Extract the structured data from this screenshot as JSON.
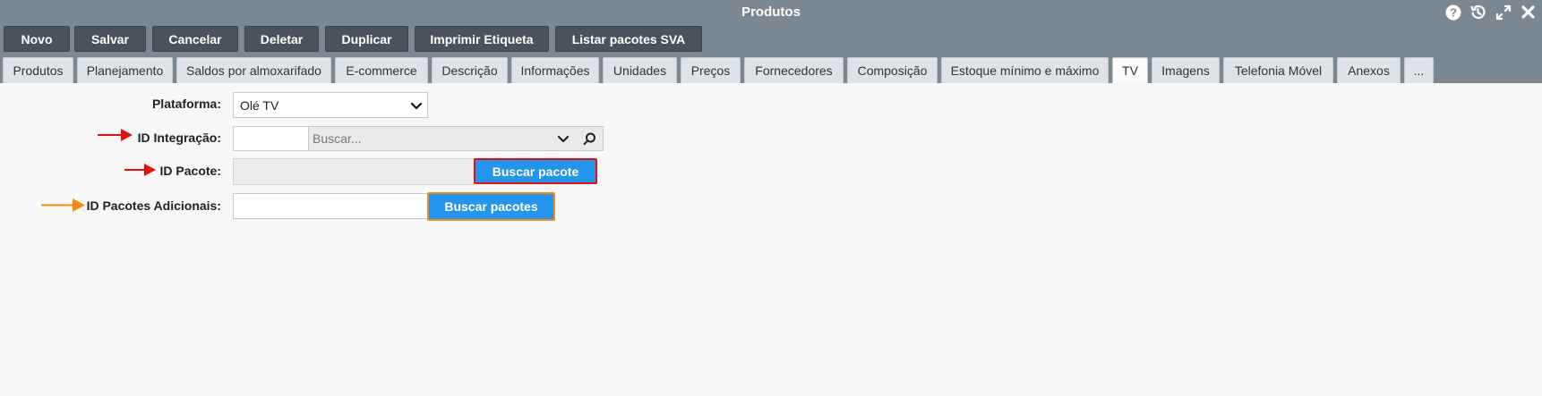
{
  "window": {
    "title": "Produtos"
  },
  "toolbar": {
    "buttons": [
      "Novo",
      "Salvar",
      "Cancelar",
      "Deletar",
      "Duplicar",
      "Imprimir Etiqueta",
      "Listar pacotes SVA"
    ]
  },
  "tabs": [
    {
      "label": "Produtos"
    },
    {
      "label": "Planejamento"
    },
    {
      "label": "Saldos por almoxarifado"
    },
    {
      "label": "E-commerce"
    },
    {
      "label": "Descrição"
    },
    {
      "label": "Informações"
    },
    {
      "label": "Unidades"
    },
    {
      "label": "Preços"
    },
    {
      "label": "Fornecedores"
    },
    {
      "label": "Composição"
    },
    {
      "label": "Estoque mínimo e máximo"
    },
    {
      "label": "TV"
    },
    {
      "label": "Imagens"
    },
    {
      "label": "Telefonia Móvel"
    },
    {
      "label": "Anexos"
    },
    {
      "label": "..."
    }
  ],
  "active_tab": "TV",
  "form": {
    "plataforma": {
      "label": "Plataforma:",
      "value": "Olé TV"
    },
    "id_integracao": {
      "label": "ID Integração:",
      "value": "",
      "search_placeholder": "Buscar..."
    },
    "id_pacote": {
      "label": "ID Pacote:",
      "value": "",
      "button": "Buscar pacote"
    },
    "id_pacotes_adicionais": {
      "label": "ID Pacotes Adicionais:",
      "value": "",
      "button": "Buscar pacotes"
    }
  },
  "colors": {
    "chrome": "#7b8892",
    "toolbar_button": "#4a535b",
    "tab": "#dde3e8",
    "primary_button": "#2495ea",
    "annotation_red": "#e21111",
    "annotation_orange": "#f28a18"
  },
  "icons": [
    "help-icon",
    "history-icon",
    "expand-icon",
    "close-icon",
    "chevron-down-icon",
    "search-icon",
    "arrow-right-icon"
  ]
}
